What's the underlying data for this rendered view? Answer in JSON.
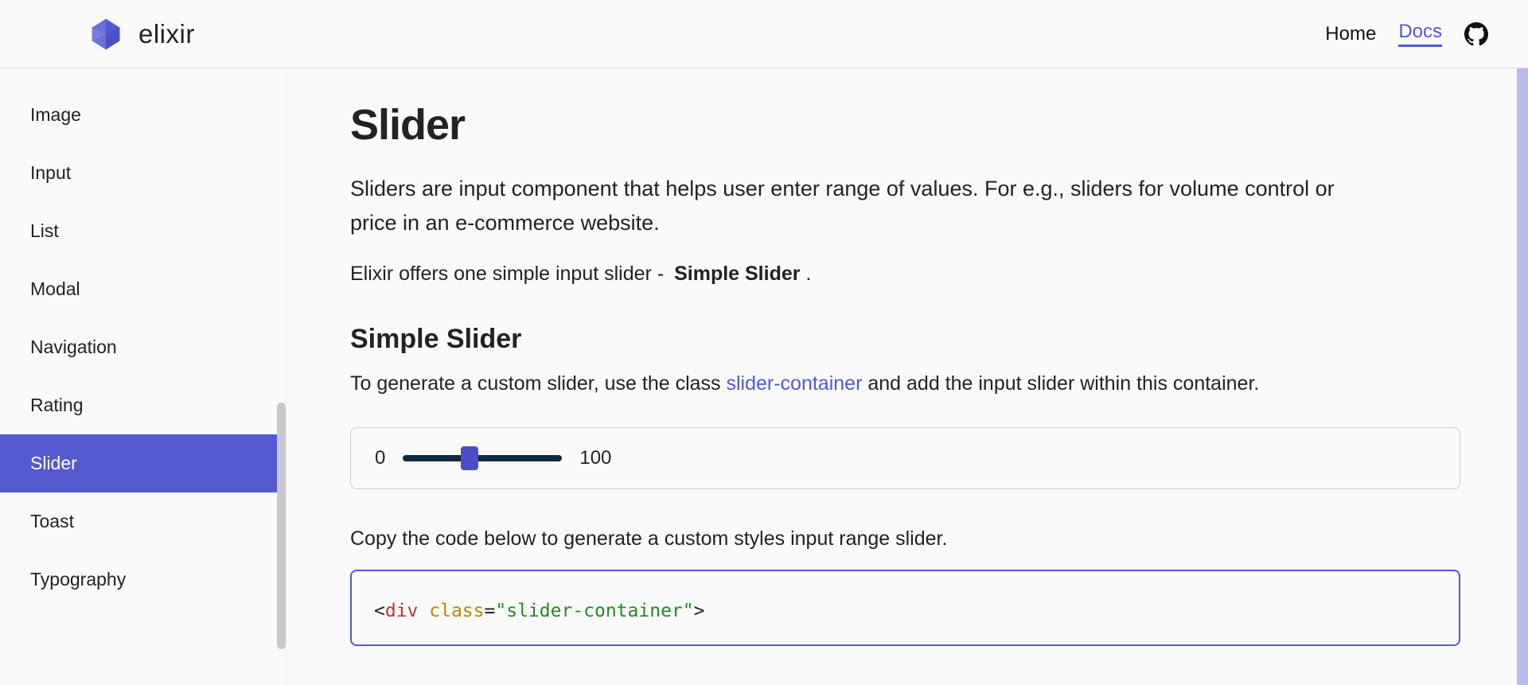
{
  "header": {
    "brand": "elixir",
    "nav": {
      "home": "Home",
      "docs": "Docs"
    }
  },
  "sidebar": {
    "items": [
      "Image",
      "Input",
      "List",
      "Modal",
      "Navigation",
      "Rating",
      "Slider",
      "Toast",
      "Typography"
    ],
    "activeIndex": 6
  },
  "main": {
    "title": "Slider",
    "desc": "Sliders are input component that helps user enter range of values. For e.g., sliders for volume control or price in an e-commerce website.",
    "offers_prefix": "Elixir offers one simple input slider - ",
    "offers_bold": "Simple Slider",
    "offers_suffix": " .",
    "section_title": "Simple Slider",
    "section_desc_pre": "To generate a custom slider, use the class ",
    "section_desc_hl": "slider-container",
    "section_desc_post": " and add the input slider within this container.",
    "slider": {
      "min": "0",
      "max": "100",
      "value": 42
    },
    "copy_text": "Copy the code below to generate a custom styles input range slider.",
    "code": {
      "lt": "<",
      "gt": ">",
      "eq": "=",
      "tag": "div",
      "attr": "class",
      "q": "\"",
      "val": "slider-container"
    }
  }
}
